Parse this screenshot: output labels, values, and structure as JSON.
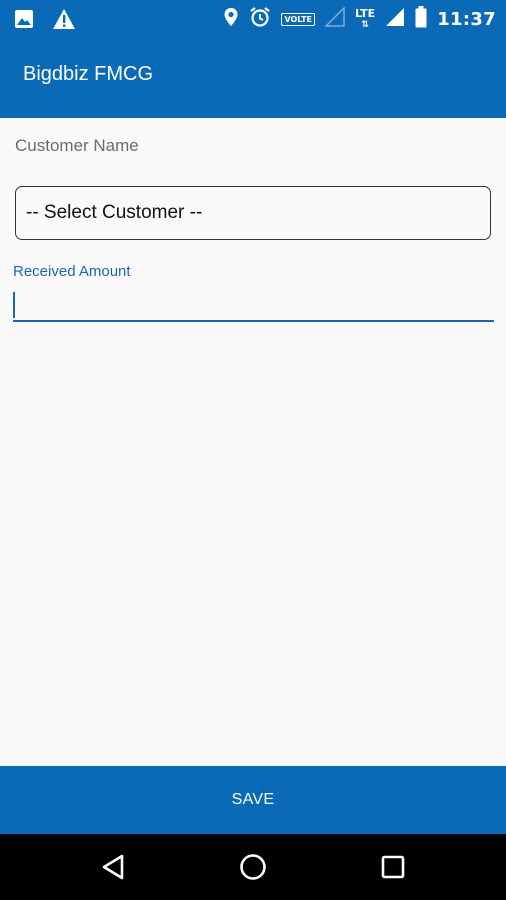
{
  "status_bar": {
    "time": "11:37",
    "volte": "VOLTE",
    "network": "LTE",
    "left_icons": [
      "image-icon",
      "warning-icon"
    ],
    "right_icons": [
      "location-icon",
      "alarm-icon",
      "volte-icon",
      "signal-empty-icon",
      "lte-icon",
      "signal-icon",
      "battery-icon"
    ]
  },
  "app_bar": {
    "title": "Bigdbiz FMCG"
  },
  "form": {
    "customer_label": "Customer Name",
    "customer_select_value": "-- Select Customer --",
    "amount_label": "Received Amount",
    "amount_value": ""
  },
  "footer": {
    "save_label": "SAVE"
  },
  "nav": {
    "buttons": [
      "back-icon",
      "home-icon",
      "recents-icon"
    ]
  },
  "colors": {
    "primary": "#0b6ab7",
    "accent": "#1d63b4",
    "background": "#fafafa",
    "nav_background": "#000000"
  }
}
